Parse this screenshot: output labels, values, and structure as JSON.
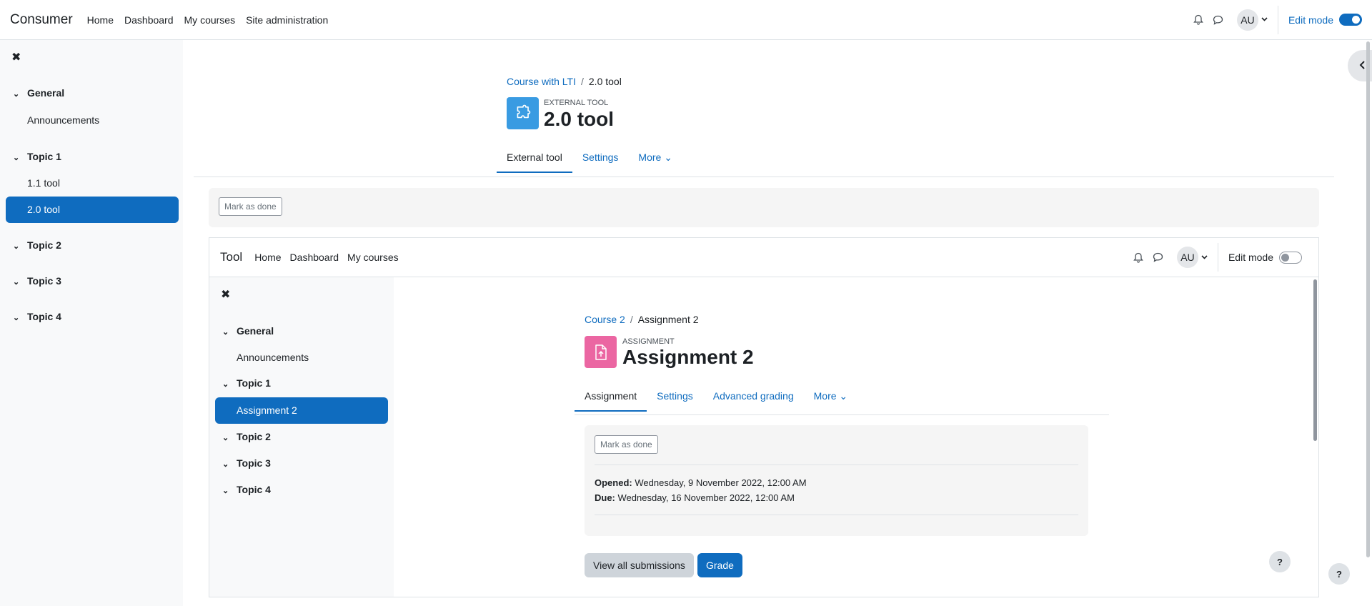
{
  "navbar": {
    "brand": "Consumer",
    "links": [
      "Home",
      "Dashboard",
      "My courses",
      "Site administration"
    ],
    "avatar": "AU",
    "edit_mode_label": "Edit mode",
    "edit_mode_on": true
  },
  "drawer": {
    "sections": [
      {
        "title": "General",
        "items": [
          "Announcements"
        ]
      },
      {
        "title": "Topic 1",
        "items": [
          "1.1 tool",
          "2.0 tool"
        ]
      },
      {
        "title": "Topic 2",
        "items": []
      },
      {
        "title": "Topic 3",
        "items": []
      },
      {
        "title": "Topic 4",
        "items": []
      }
    ],
    "active_item": "2.0 tool"
  },
  "main": {
    "breadcrumb": [
      "Course with LTI",
      "2.0 tool"
    ],
    "activity_type": "EXTERNAL TOOL",
    "title": "2.0 tool",
    "tabs": [
      "External tool",
      "Settings",
      "More"
    ],
    "active_tab": "External tool",
    "mark_done": "Mark as done"
  },
  "iframe": {
    "brand": "Tool",
    "links": [
      "Home",
      "Dashboard",
      "My courses"
    ],
    "avatar": "AU",
    "edit_mode_label": "Edit mode",
    "edit_mode_on": false,
    "drawer": {
      "sections": [
        {
          "title": "General",
          "items": [
            "Announcements"
          ]
        },
        {
          "title": "Topic 1",
          "items": [
            "Assignment 2"
          ]
        },
        {
          "title": "Topic 2",
          "items": []
        },
        {
          "title": "Topic 3",
          "items": []
        },
        {
          "title": "Topic 4",
          "items": []
        }
      ],
      "active_item": "Assignment 2"
    },
    "main": {
      "breadcrumb": [
        "Course 2",
        "Assignment 2"
      ],
      "activity_type": "ASSIGNMENT",
      "title": "Assignment 2",
      "tabs": [
        "Assignment",
        "Settings",
        "Advanced grading",
        "More"
      ],
      "active_tab": "Assignment",
      "mark_done": "Mark as done",
      "opened_label": "Opened:",
      "opened_value": "Wednesday, 9 November 2022, 12:00 AM",
      "due_label": "Due:",
      "due_value": "Wednesday, 16 November 2022, 12:00 AM",
      "view_all": "View all submissions",
      "grade": "Grade"
    }
  },
  "help_label": "?",
  "colors": {
    "primary": "#0f6cbf",
    "external_tool_icon": "#399be2",
    "assignment_icon": "#eb66a2"
  }
}
